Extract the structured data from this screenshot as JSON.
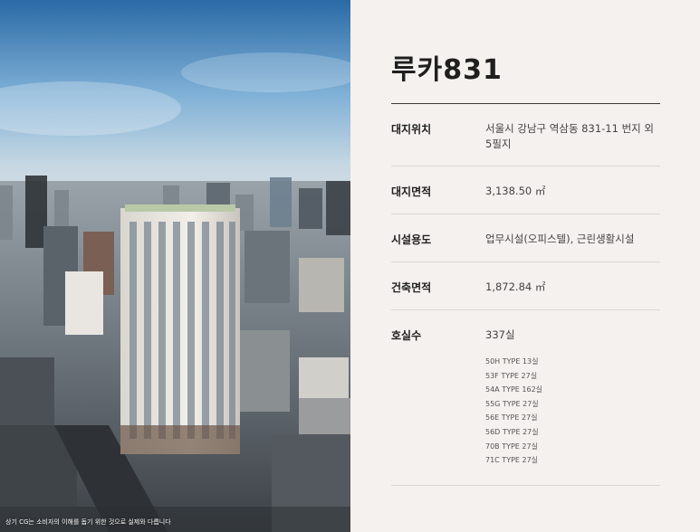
{
  "photo": {
    "caption": "상기 CG는 소비자의 이해를 돕기 위한 것으로 실제와 다릅니다"
  },
  "header": {
    "title": "루카831"
  },
  "info": {
    "rows": [
      {
        "label": "대지위치",
        "value_line1": "서울시 강남구 역삼동 831-11 번지 외",
        "value_line2": "5필지"
      },
      {
        "label": "대지면적",
        "value": "3,138.50 ㎡"
      },
      {
        "label": "시설용도",
        "value": "업무시설(오피스텔), 근린생활시설"
      },
      {
        "label": "건축면적",
        "value": "1,872.84 ㎡"
      },
      {
        "label": "호실수",
        "value": "337실",
        "types": [
          "50H TYPE 13실",
          "53F TYPE 27실",
          "54A TYPE 162실",
          "55G TYPE 27실",
          "56E TYPE 27실",
          "56D TYPE 27실",
          "70B TYPE 27실",
          "71C TYPE 27실"
        ]
      }
    ]
  }
}
